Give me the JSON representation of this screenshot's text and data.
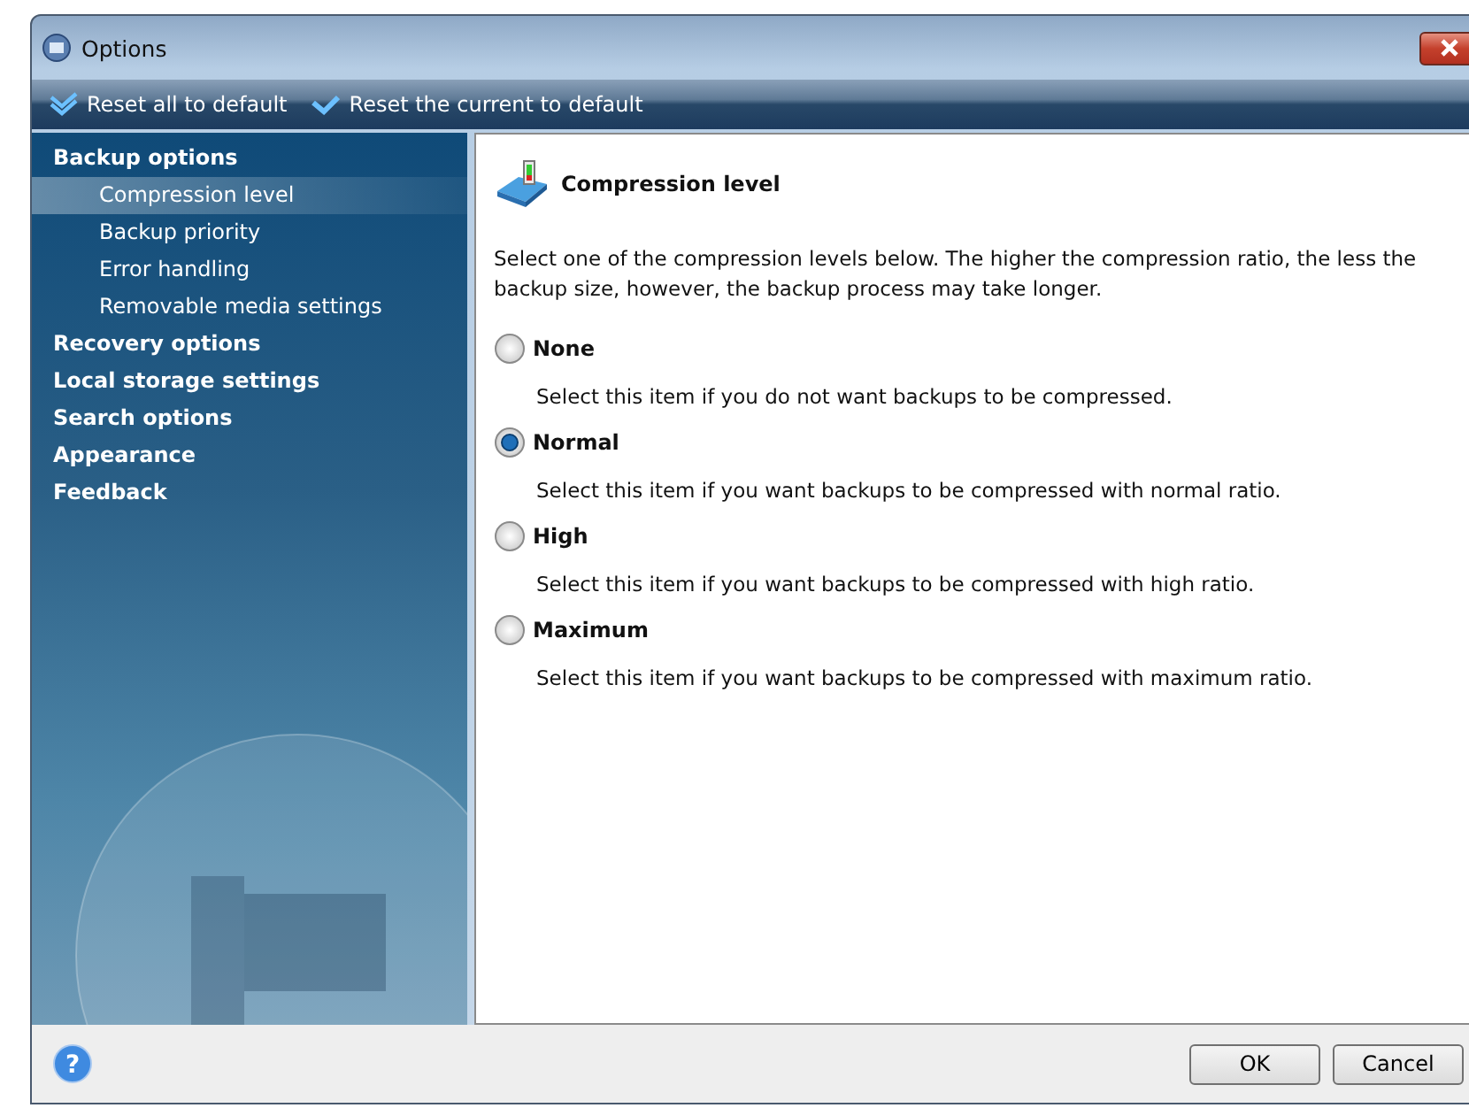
{
  "window": {
    "title": "Options"
  },
  "toolbar": [
    {
      "label": "Reset all to default",
      "kind": "double"
    },
    {
      "label": "Reset the current to default",
      "kind": "single"
    }
  ],
  "sidebar": {
    "items": [
      {
        "label": "Backup options",
        "selected": false,
        "children": [
          {
            "label": "Compression level",
            "selected": true
          },
          {
            "label": "Backup priority",
            "selected": false
          },
          {
            "label": "Error handling",
            "selected": false
          },
          {
            "label": "Removable media settings",
            "selected": false
          }
        ]
      },
      {
        "label": "Recovery options",
        "selected": false
      },
      {
        "label": "Local storage settings",
        "selected": false
      },
      {
        "label": "Search options",
        "selected": false
      },
      {
        "label": "Appearance",
        "selected": false
      },
      {
        "label": "Feedback",
        "selected": false
      }
    ]
  },
  "panel": {
    "title": "Compression level",
    "description": "Select one of the compression levels below. The higher the compression ratio, the less the backup size, however, the backup process may take longer.",
    "options": [
      {
        "label": "None",
        "hint": "Select this item if you do not want backups to be compressed.",
        "selected": false
      },
      {
        "label": "Normal",
        "hint": "Select this item if you want backups to be compressed with normal ratio.",
        "selected": true
      },
      {
        "label": "High",
        "hint": "Select this item if you want backups to be compressed with high ratio.",
        "selected": false
      },
      {
        "label": "Maximum",
        "hint": "Select this item if you want backups to be compressed with maximum ratio.",
        "selected": false
      }
    ]
  },
  "help": "?",
  "buttons": [
    "OK",
    "Cancel"
  ]
}
